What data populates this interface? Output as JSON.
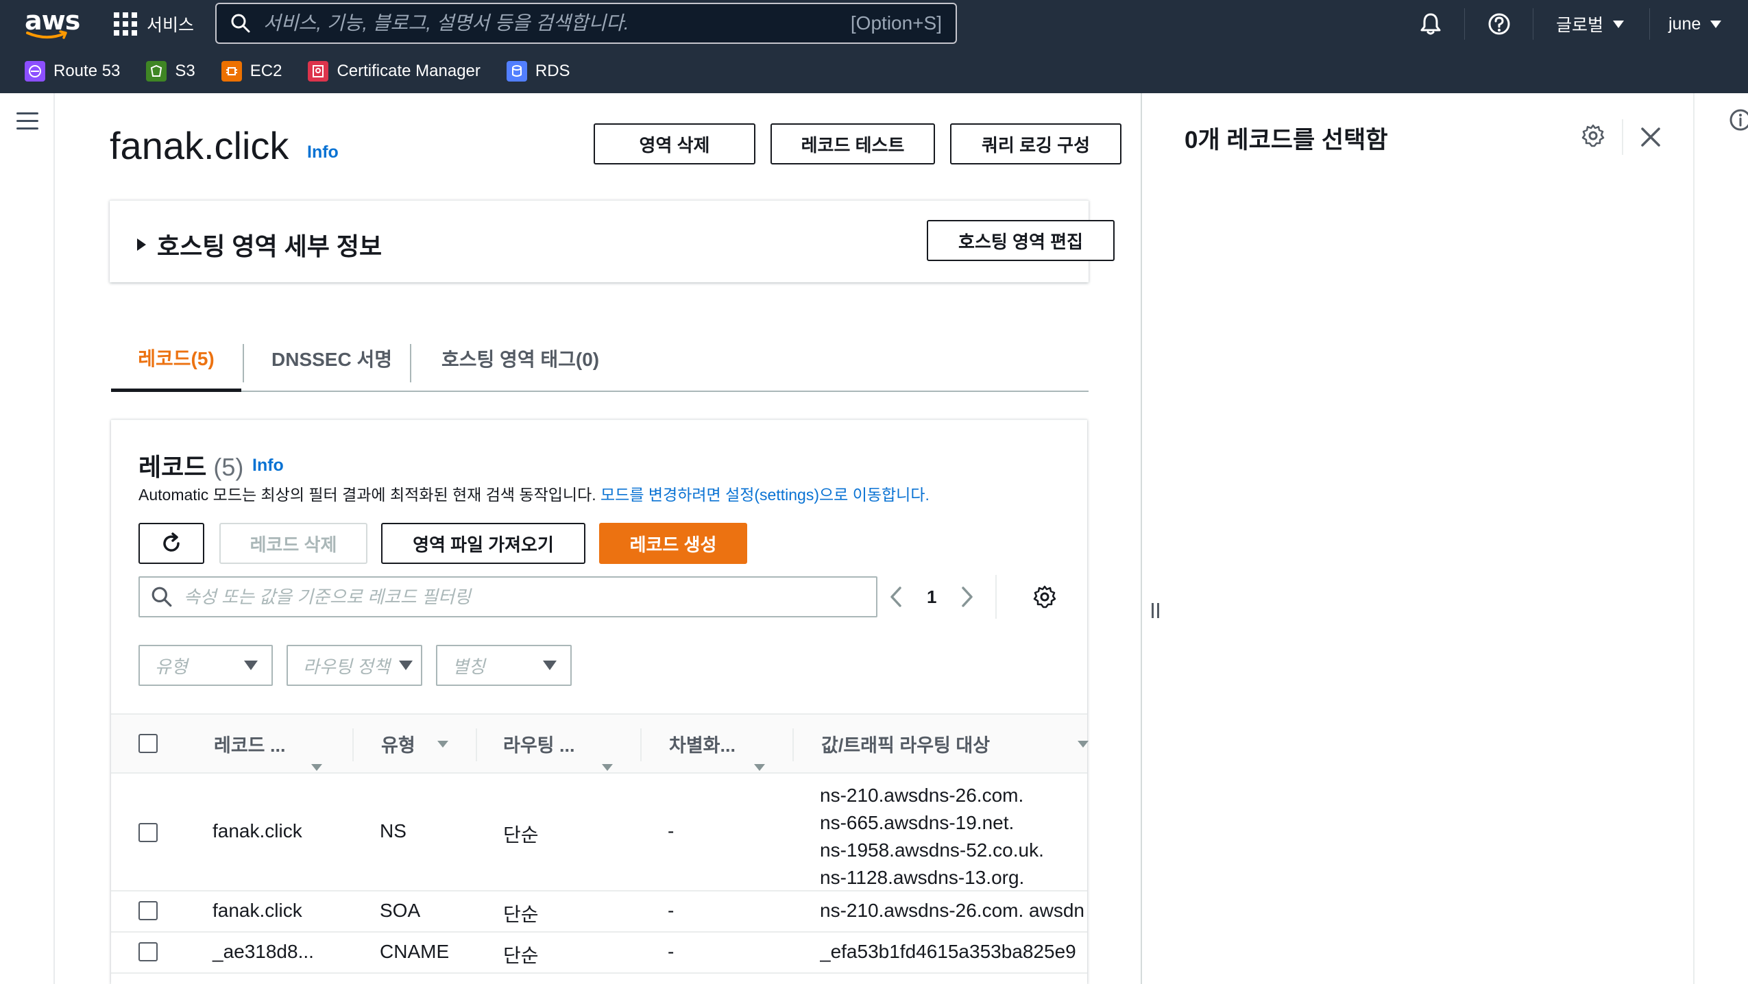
{
  "nav": {
    "services_label": "서비스",
    "search_placeholder": "서비스, 기능, 블로그, 설명서 등을 검색합니다.",
    "search_shortcut": "[Option+S]",
    "region_label": "글로벌",
    "user_label": "june",
    "favorites": [
      {
        "label": "Route 53",
        "icon": "route53-icon",
        "color": "#8c4fff"
      },
      {
        "label": "S3",
        "icon": "s3-icon",
        "color": "#3f8624"
      },
      {
        "label": "EC2",
        "icon": "ec2-icon",
        "color": "#ed7100"
      },
      {
        "label": "Certificate Manager",
        "icon": "certificate-manager-icon",
        "color": "#dd344c"
      },
      {
        "label": "RDS",
        "icon": "rds-icon",
        "color": "#527fff"
      }
    ]
  },
  "header": {
    "title": "fanak.click",
    "info": "Info",
    "delete_zone": "영역 삭제",
    "test_record": "레코드 테스트",
    "query_logging": "쿼리 로깅 구성"
  },
  "details": {
    "title": "호스팅 영역 세부 정보",
    "edit_button": "호스팅 영역 편집"
  },
  "tabs": [
    {
      "label": "레코드(5)"
    },
    {
      "label": "DNSSEC 서명"
    },
    {
      "label": "호스팅 영역 태그(0)"
    }
  ],
  "records": {
    "title": "레코드",
    "count": "(5)",
    "info": "Info",
    "desc_prefix": "Automatic 모드는 최상의 필터 결과에 최적화된 현재 검색 동작입니다.",
    "desc_link": "모드를 변경하려면 설정(settings)으로 이동합니다.",
    "delete_button": "레코드 삭제",
    "import_button": "영역 파일 가져오기",
    "create_button": "레코드 생성",
    "filter_placeholder": "속성 또는 값을 기준으로 레코드 필터링",
    "page_number": "1",
    "filters": [
      {
        "placeholder": "유형"
      },
      {
        "placeholder": "라우팅 정책"
      },
      {
        "placeholder": "별칭"
      }
    ],
    "columns": [
      "레코드 ...",
      "유형",
      "라우팅 ...",
      "차별화...",
      "값/트래픽 라우팅 대상"
    ],
    "rows": [
      {
        "name": "fanak.click",
        "type": "NS",
        "routing": "단순",
        "diff": "-",
        "value": [
          "ns-210.awsdns-26.com.",
          "ns-665.awsdns-19.net.",
          "ns-1958.awsdns-52.co.uk.",
          "ns-1128.awsdns-13.org."
        ]
      },
      {
        "name": "fanak.click",
        "type": "SOA",
        "routing": "단순",
        "diff": "-",
        "value": [
          "ns-210.awsdns-26.com. awsdn"
        ]
      },
      {
        "name": "_ae318d8...",
        "type": "CNAME",
        "routing": "단순",
        "diff": "-",
        "value": [
          "_efa53b1fd4615a353ba825e9"
        ]
      }
    ]
  },
  "split_panel": {
    "title": "0개 레코드를 선택함"
  }
}
